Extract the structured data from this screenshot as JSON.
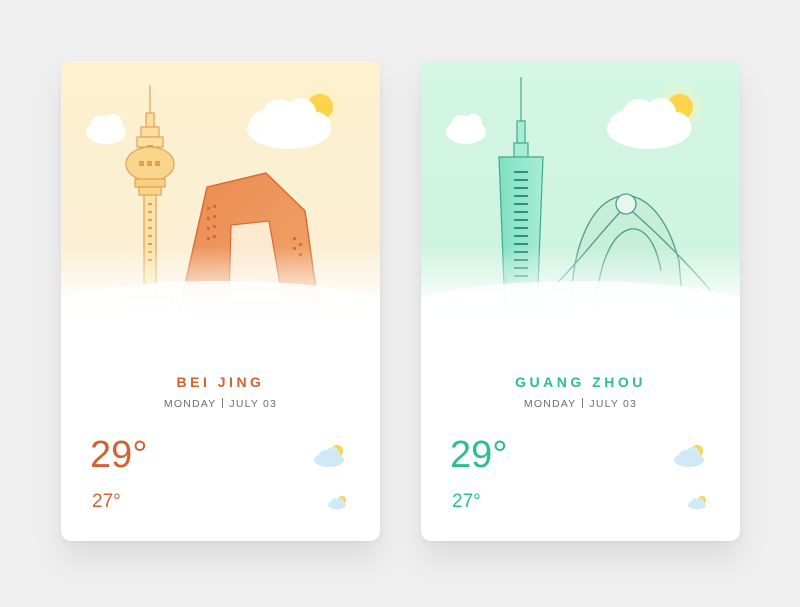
{
  "cards": [
    {
      "city": "BEI JING",
      "day": "MONDAY",
      "date": "JULY 03",
      "temp_main": "29°",
      "temp_low": "27°",
      "accent": "#cf6333",
      "scene_bg": "#fdf1cf"
    },
    {
      "city": "GUANG ZHOU",
      "day": "MONDAY",
      "date": "JULY 03",
      "temp_main": "29°",
      "temp_low": "27°",
      "accent": "#2dbe8f",
      "scene_bg": "#d4f6e4"
    }
  ],
  "icons": {
    "weather_main": "partly-cloudy-icon",
    "weather_low": "partly-cloudy-icon"
  }
}
